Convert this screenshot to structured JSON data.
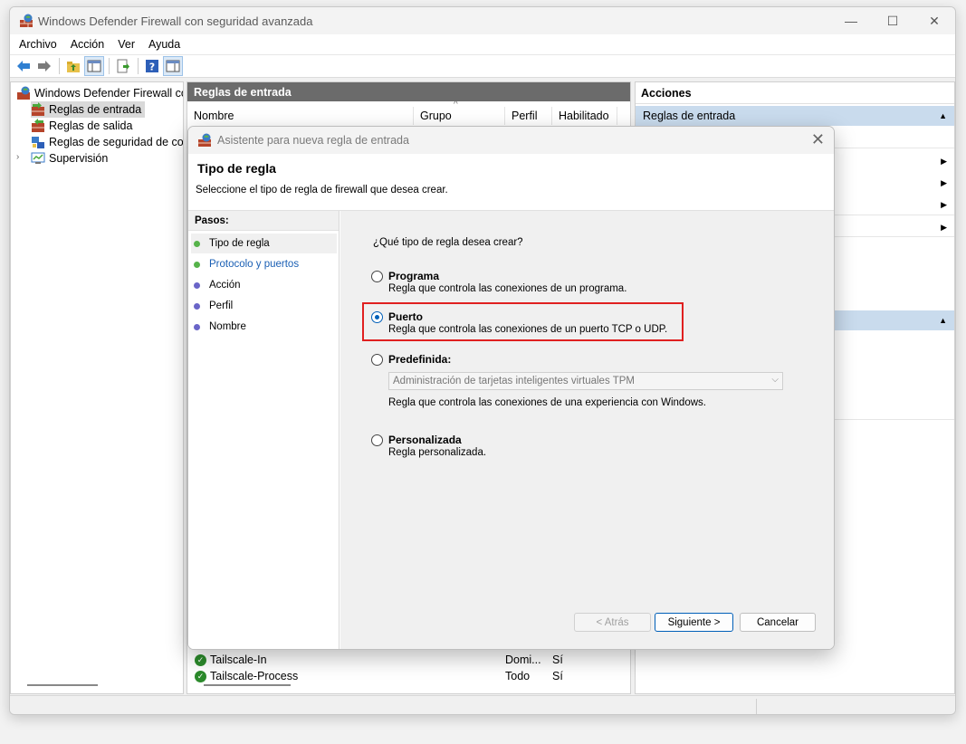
{
  "window": {
    "title": "Windows Defender Firewall con seguridad avanzada",
    "minimize": "—",
    "maximize": "☐",
    "close": "✕"
  },
  "menu": [
    "Archivo",
    "Acción",
    "Ver",
    "Ayuda"
  ],
  "tree": {
    "root": "Windows Defender Firewall con",
    "items": [
      "Reglas de entrada",
      "Reglas de salida",
      "Reglas de seguridad de con",
      "Supervisión"
    ]
  },
  "center": {
    "header": "Reglas de entrada",
    "columns": [
      "Nombre",
      "Grupo",
      "Perfil",
      "Habilitado"
    ],
    "rows": [
      {
        "name": "Tailscale-In",
        "perfil": "Domi...",
        "habilitado": "Sí"
      },
      {
        "name": "Tailscale-Process",
        "perfil": "Todo",
        "habilitado": "Sí"
      }
    ]
  },
  "actions": {
    "header": "Acciones",
    "section1": "Reglas de entrada"
  },
  "dialog": {
    "title": "Asistente para nueva regla de entrada",
    "heading": "Tipo de regla",
    "subheading": "Seleccione el tipo de regla de firewall que desea crear.",
    "steps_label": "Pasos:",
    "steps": [
      "Tipo de regla",
      "Protocolo y puertos",
      "Acción",
      "Perfil",
      "Nombre"
    ],
    "question": "¿Qué tipo de regla desea crear?",
    "options": [
      {
        "title": "Programa",
        "desc": "Regla que controla las conexiones de un programa."
      },
      {
        "title": "Puerto",
        "desc": "Regla que controla las conexiones de un puerto TCP o UDP."
      },
      {
        "title": "Predefinida:",
        "desc": "Regla que controla las conexiones de una experiencia con Windows."
      },
      {
        "title": "Personalizada",
        "desc": "Regla personalizada."
      }
    ],
    "predefined_value": "Administración de tarjetas inteligentes virtuales TPM",
    "buttons": {
      "back": "< Atrás",
      "next": "Siguiente >",
      "cancel": "Cancelar"
    }
  }
}
